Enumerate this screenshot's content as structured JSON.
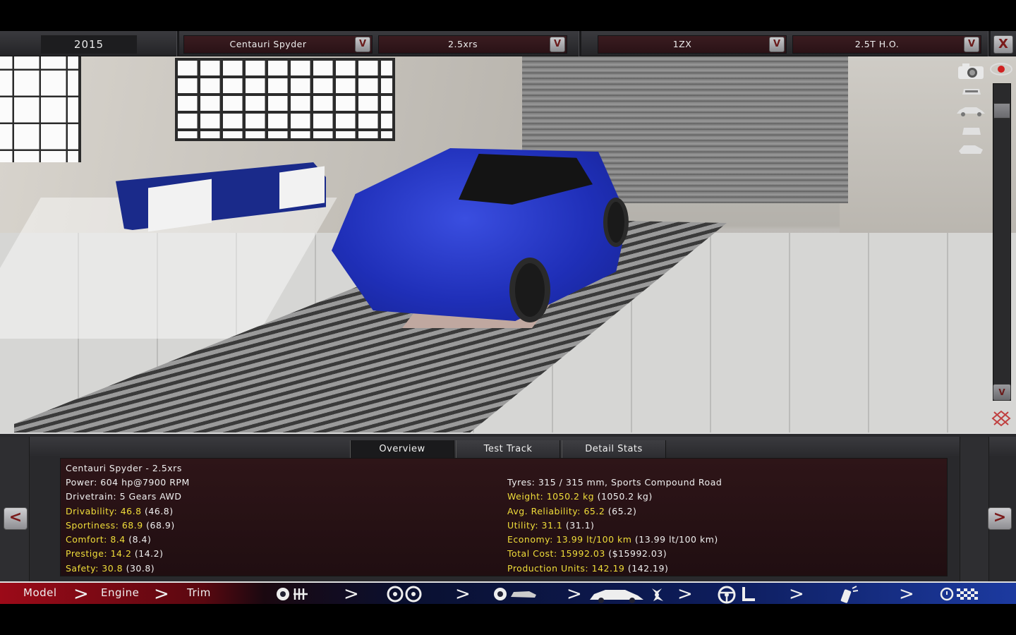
{
  "topbar": {
    "year": "2015",
    "model": "Centauri Spyder",
    "trim": "2.5xrs",
    "engine_family": "1ZX",
    "engine_variant": "2.5T H.O.",
    "dropdown_glyph": "V",
    "close_glyph": "X"
  },
  "right_toolbar": {
    "scroll_up": "^",
    "scroll_down": "V"
  },
  "tabs": [
    {
      "label": "Overview"
    },
    {
      "label": "Test Track"
    },
    {
      "label": "Detail Stats"
    }
  ],
  "stats": {
    "title": "Centauri Spyder - 2.5xrs",
    "power": "Power: 604 hp@7900 RPM",
    "drivetrain": "Drivetrain: 5 Gears AWD",
    "drivability_k": "Drivability: 46.8",
    "drivability_p": " (46.8)",
    "sportiness_k": "Sportiness: 68.9",
    "sportiness_p": " (68.9)",
    "comfort_k": "Comfort: 8.4",
    "comfort_p": " (8.4)",
    "prestige_k": "Prestige: 14.2",
    "prestige_p": " (14.2)",
    "safety_k": "Safety: 30.8",
    "safety_p": " (30.8)",
    "tyres": "Tyres: 315 / 315 mm, Sports Compound Road",
    "weight_k": "Weight: 1050.2 kg",
    "weight_p": " (1050.2 kg)",
    "reliability_k": "Avg. Reliability: 65.2",
    "reliability_p": " (65.2)",
    "utility_k": "Utility: 31.1",
    "utility_p": " (31.1)",
    "economy_k": "Economy: 13.99 lt/100 km",
    "economy_p": " (13.99 lt/100 km)",
    "cost_k": "Total Cost: 15992.03",
    "cost_p": " ($15992.03)",
    "units_k": "Production Units: 142.19",
    "units_p": " (142.19)"
  },
  "pager": {
    "prev": "<",
    "next": ">"
  },
  "nav": {
    "model": "Model",
    "engine": "Engine",
    "trim": "Trim",
    "chevron": ">"
  },
  "colors": {
    "accent_red": "#9c0a18",
    "accent_blue": "#1c3aa0",
    "stat_yellow": "#f0dd3a"
  }
}
